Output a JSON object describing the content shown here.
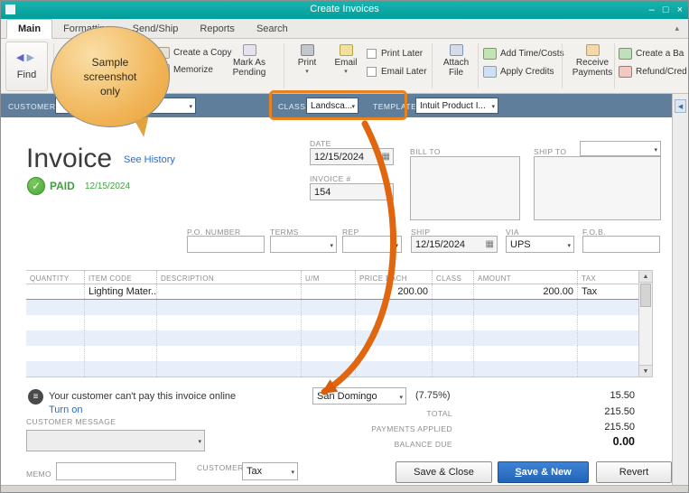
{
  "window": {
    "title": "Create Invoices"
  },
  "colors": {
    "titlebar": "#00a5a3",
    "header_bar": "#5e7e9c",
    "highlight": "#e8821e",
    "primary_button": "#2a6fc4",
    "paid_green": "#3f9f3f",
    "row_alt": "#e7f0fa"
  },
  "icons": {
    "minimize": "–",
    "maximize": "□",
    "close": "×",
    "caret": "▾",
    "calendar": "▦",
    "check": "✓",
    "chevron_up": "▴",
    "back_arrow": "◀",
    "forward_arrow": "▶",
    "scroll_up": "▲",
    "scroll_down": "▼",
    "menu_lines": "≡",
    "panel_left_arrow": "◀"
  },
  "tabs": {
    "items": [
      {
        "label": "Main"
      },
      {
        "label": "Formatting"
      },
      {
        "label": "Send/Ship"
      },
      {
        "label": "Reports"
      },
      {
        "label": "Search"
      }
    ]
  },
  "toolbar": {
    "find_label": "Find",
    "create_a_copy": "Create a Copy",
    "memorize": "Memorize",
    "mark_as_pending": "Mark As\nPending",
    "print_label": "Print",
    "email_label": "Email",
    "print_later": "Print Later",
    "email_later": "Email Later",
    "attach_file": "Attach\nFile",
    "add_time_costs": "Add Time/Costs",
    "apply_credits": "Apply Credits",
    "receive_payments": "Receive\nPayments",
    "create_a_batch": "Create a Ba",
    "refund_credit": "Refund/Cred"
  },
  "header_bar": {
    "customer_label": "CUSTOMER",
    "class_label": "CLASS",
    "class_value": "Landsca...",
    "template_label": "TEMPLATE",
    "template_value": "Intuit Product I..."
  },
  "invoice": {
    "title": "Invoice",
    "see_history": "See History",
    "paid_label": "PAID",
    "paid_date": "12/15/2024",
    "date_label": "DATE",
    "date_value": "12/15/2024",
    "invoice_number_label": "INVOICE #",
    "invoice_number": "154",
    "bill_to_label": "BILL TO",
    "ship_to_label": "SHIP TO",
    "po_number_label": "P.O. NUMBER",
    "terms_label": "TERMS",
    "rep_label": "REP",
    "ship_label": "SHIP",
    "ship_date": "12/15/2024",
    "via_label": "VIA",
    "via_value": "UPS",
    "fob_label": "F.O.B."
  },
  "table": {
    "headers": [
      "QUANTITY",
      "ITEM CODE",
      "DESCRIPTION",
      "U/M",
      "PRICE EACH",
      "CLASS",
      "AMOUNT",
      "TAX"
    ],
    "rows": [
      {
        "quantity": "",
        "item_code": "Lighting Mater...",
        "description": "",
        "um": "",
        "price_each": "200.00",
        "class": "",
        "amount": "200.00",
        "tax": "Tax"
      }
    ]
  },
  "totals": {
    "online_notice": "Your customer can't pay this invoice online",
    "turn_on": "Turn on",
    "tax_name": "San Domingo",
    "tax_rate": "(7.75%)",
    "tax_amount": "15.50",
    "total_label": "TOTAL",
    "total_value": "215.50",
    "payments_applied_label": "PAYMENTS APPLIED",
    "payments_applied_value": "215.50",
    "balance_due_label": "BALANCE DUE",
    "balance_due_value": "0.00"
  },
  "footer": {
    "customer_message_label": "CUSTOMER MESSAGE",
    "memo_label": "MEMO",
    "customer_tax_code_label": "CUSTOMER\nTAX CODE",
    "customer_tax_code_value": "Tax",
    "save_close": "Save & Close",
    "save_new": "Save & New",
    "revert": "Revert"
  },
  "annotation": {
    "balloon_text": "Sample\nscreenshot\nonly"
  }
}
